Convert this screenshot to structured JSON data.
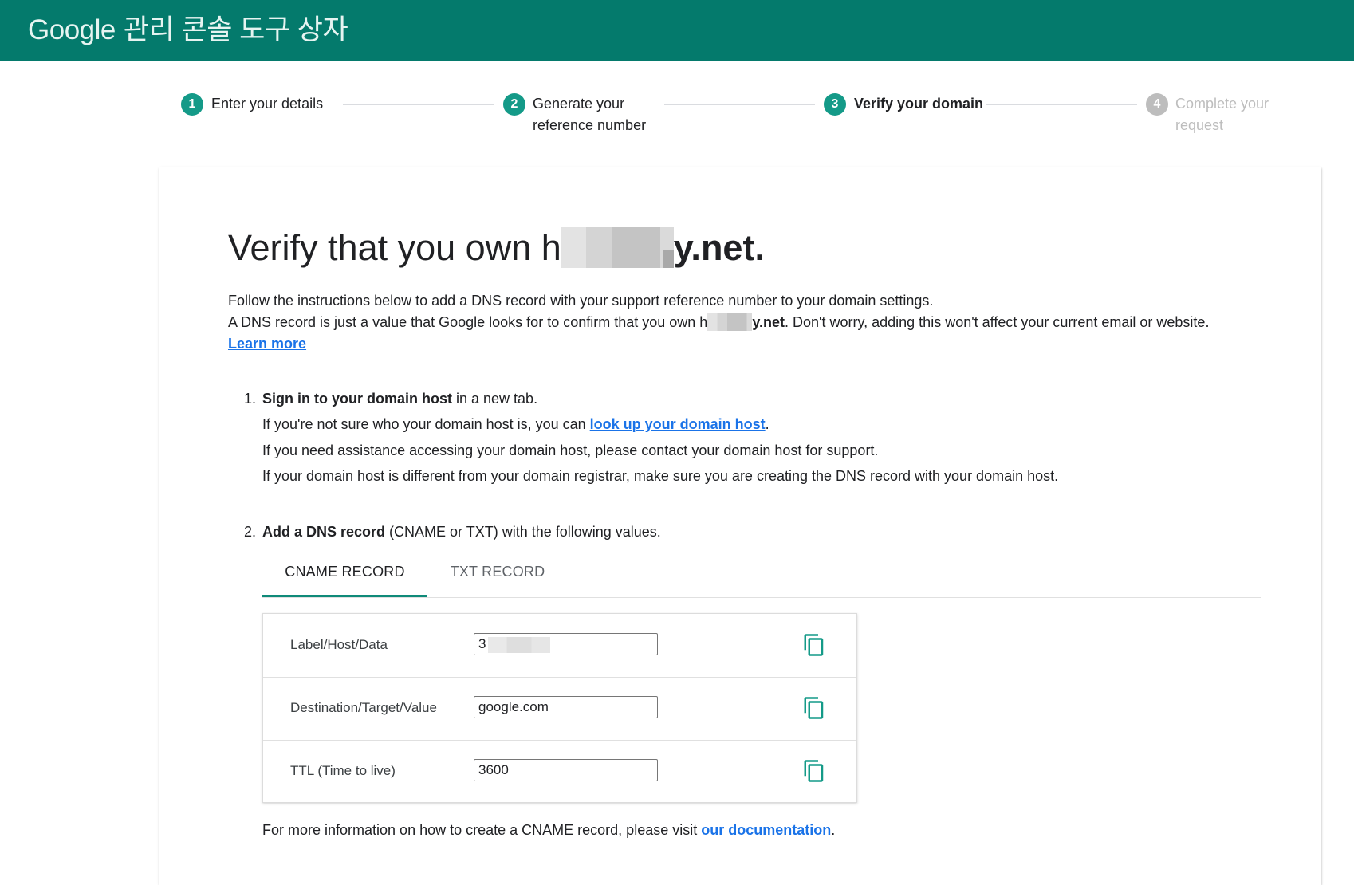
{
  "header": {
    "brand": "Google",
    "title": "관리 콘솔 도구 상자"
  },
  "stepper": {
    "active_step": 3,
    "steps": [
      {
        "num": "1",
        "label": "Enter your details",
        "state": "done"
      },
      {
        "num": "2",
        "label": "Generate your reference number",
        "state": "done"
      },
      {
        "num": "3",
        "label": "Verify your domain",
        "state": "active"
      },
      {
        "num": "4",
        "label": "Complete your request",
        "state": "inactive"
      }
    ]
  },
  "card": {
    "title_prefix": "Verify that you own ",
    "title_domain_start": "h",
    "title_domain_end": "y.net.",
    "intro_line1": "Follow the instructions below to add a DNS record with your support reference number to your domain settings.",
    "intro_line2_prefix": "A DNS record is just a value that Google looks for to confirm that you own ",
    "intro_domain_start": "h",
    "intro_domain_end": "y.net",
    "intro_line2_suffix": ". Don't worry, adding this won't affect your current email or website.",
    "learn_more": "Learn more"
  },
  "instructions": [
    {
      "num": "1.",
      "bold": "Sign in to your domain host",
      "rest": " in a new tab.",
      "details": [
        {
          "prefix": "If you're not sure who your domain host is, you can ",
          "link": "look up your domain host",
          "suffix": "."
        },
        {
          "text": "If you need assistance accessing your domain host, please contact your domain host for support."
        },
        {
          "text": "If your domain host is different from your domain registrar, make sure you are creating the DNS record with your domain host."
        }
      ]
    },
    {
      "num": "2.",
      "bold": "Add a DNS record",
      "rest": " (CNAME or TXT) with the following values."
    }
  ],
  "tabs": {
    "active": "cname",
    "items": [
      {
        "id": "cname",
        "label": "CNAME RECORD"
      },
      {
        "id": "txt",
        "label": "TXT RECORD"
      }
    ]
  },
  "records": {
    "rows": [
      {
        "label": "Label/Host/Data",
        "value": "3",
        "redacted": true,
        "copy_icon": "copy-icon"
      },
      {
        "label": "Destination/Target/Value",
        "value": "google.com",
        "copy_icon": "copy-icon"
      },
      {
        "label": "TTL (Time to live)",
        "value": "3600",
        "copy_icon": "copy-icon"
      }
    ]
  },
  "footer": {
    "prefix": "For more information on how to create a CNAME record, please visit ",
    "link": "our documentation",
    "suffix": "."
  },
  "colors": {
    "header_bg": "#047a6c",
    "accent": "#149a88",
    "link": "#1a73e8",
    "inactive": "#bdbdbd"
  }
}
